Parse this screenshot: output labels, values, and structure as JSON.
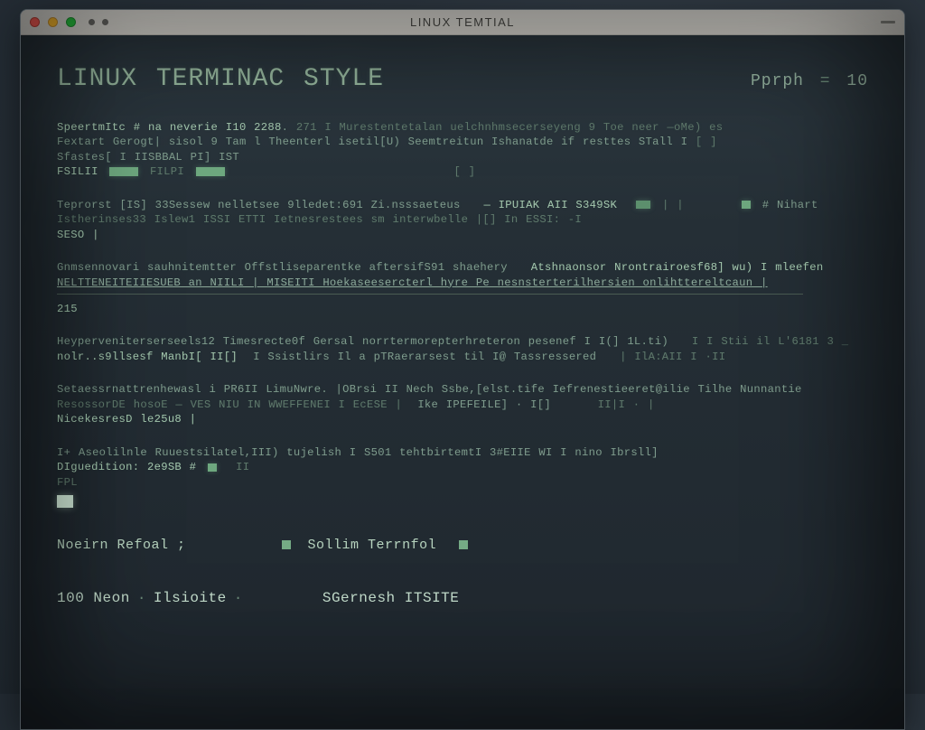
{
  "window": {
    "title": "LInux Temtial"
  },
  "header": {
    "title": "LINUX TERMINAC STYLE",
    "pph_label": "Pprph",
    "pph_value": "10"
  },
  "blocks": [
    {
      "l1a": "SpeertmItc # na neverie  I10 2288",
      "l1b": "271 I Murestentetalan uelchnhmsecerseyeng   9   Toe neer —oMe) es",
      "l2a": "Fextart Gerogt| sisol 9 Tam l Theenterl isetil[U) Seemtreitun Ishanatde if resttes STall I",
      "l2b": "  [ ]",
      "l3a": "Sfastes[ I IISBBAL PI] IST",
      "l4a": "FSILII",
      "l4b": "FILPI"
    },
    {
      "l1a": "Teprorst [IS] 33Sessew nelletsee 9lledet:691 Zi.nsssaeteus",
      "l1b": "— IPUIAK AII S349SK",
      "l1c": "# Nihart",
      "l2a": "Istherinses33 Islew1  ISSI ETTI Ietnesrestees sm interwbelle |[] In ESSI:   -I",
      "l3a": "SESO |"
    },
    {
      "l1a": "Gnmsennovari sauhnitemtter Offstliseparentke aftersifS91 shaehery",
      "l1b": "Atshnaonsor Nrontrairoesf68] wu) I mleefen",
      "l2a": "NELTTENEITEIIESUEB  an NIILI | MISEITI  Hoekaseesercterl hyre Pe nesnsterterilhersien onlihttereltcaun |",
      "l3a": "215"
    },
    {
      "l1a": "Heyperveniterserseels12 Timesrecte0f  Gersal norrtermorepterhreteron pesenef I I(] 1L.ti)",
      "l1b": "I I Stii il L'6181 3 _",
      "l2a": "nolr..s9llsesf ManbI[ II[]",
      "l2b": "I Ssistlirs Il a pTRaerarsest til I@ Tassressered",
      "l2c": "| IlA:AII   I  ·II"
    },
    {
      "l1a": "Setaessrnattrenhewasl i PR6II LimuNwre. |OBrsi II Nech Ssbe,[elst.tife Iefrenestieeret@ilie  Tilhe Nunnantie",
      "l2a": "ResossorDE hosoE  — VES NIU  IN WWEFFENEI I EcESE |",
      "l2b": "Ike IPEFEILE] · I[]",
      "l2c": "II|I · |",
      "l3a": "NicekesresD   le25u8 |"
    },
    {
      "l1a": "I+ Aseolilnle Ruuestsilatel,III) tujelish I S501 tehtbirtemtI 3#EIIE WI  I nino Ibrsll]",
      "l2a": "DIguedition:   2e9SB #",
      "l2b": "II",
      "l3a": "FPL"
    }
  ],
  "footer_a": {
    "left": "Noeirn Refoal ;",
    "right": "Sollim Terrnfol"
  },
  "footer_b": {
    "left_a": "100 Neon",
    "left_b": "Ilsioite",
    "right": "SGernesh ITSITE"
  }
}
